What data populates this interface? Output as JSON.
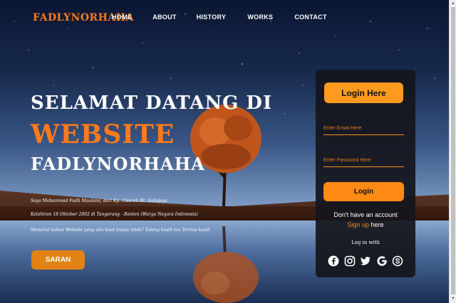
{
  "nav": {
    "brand": "FADLYNORHAHA",
    "items": [
      {
        "label": "HOME"
      },
      {
        "label": "ABOUT"
      },
      {
        "label": "HISTORY"
      },
      {
        "label": "WORKS"
      },
      {
        "label": "CONTACT"
      }
    ]
  },
  "hero": {
    "welcome": "SELAMAT DATANG DI",
    "website": "WEBSITE",
    "name": "FADLYNORHAHA",
    "paragraphs": [
      "Saya Mohammad Fadli Maulana, dari Kp. Cisereh Rt. Sadajaya",
      "Kelahiran 18 Oktober 2002 di Tangerang - Banten (Warga Negara Indonesia)",
      "Menurut kalian Website yang aku buat bagus tidak? Tolong kasih tau Terima kasih"
    ],
    "saran_label": "SARAN"
  },
  "login": {
    "title": "Login Here",
    "email_placeholder": "Enter Email Here",
    "password_placeholder": "Enter Password Here",
    "button_label": "Login",
    "no_account": "Don't have an account",
    "signup_label": "Sign up",
    "signup_suffix": " here",
    "login_with": "Log in with",
    "socials": [
      "facebook-icon",
      "instagram-icon",
      "twitter-icon",
      "google-icon",
      "skype-icon"
    ]
  },
  "colors": {
    "accent": "#ff8a14",
    "card_bg": "#14161c",
    "text": "#ffffff"
  }
}
